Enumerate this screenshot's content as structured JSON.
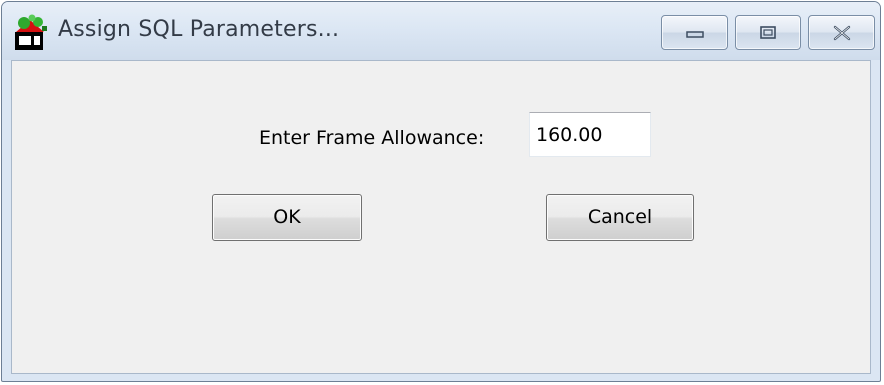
{
  "window": {
    "title": "Assign SQL Parameters...",
    "icon": "app-icon"
  },
  "caption_buttons": {
    "minimize": "minimize-icon",
    "maximize": "maximize-icon",
    "close": "close-icon"
  },
  "form": {
    "frame_allowance_label": "Enter Frame Allowance:",
    "frame_allowance_value": "160.00"
  },
  "buttons": {
    "ok_label": "OK",
    "cancel_label": "Cancel"
  }
}
